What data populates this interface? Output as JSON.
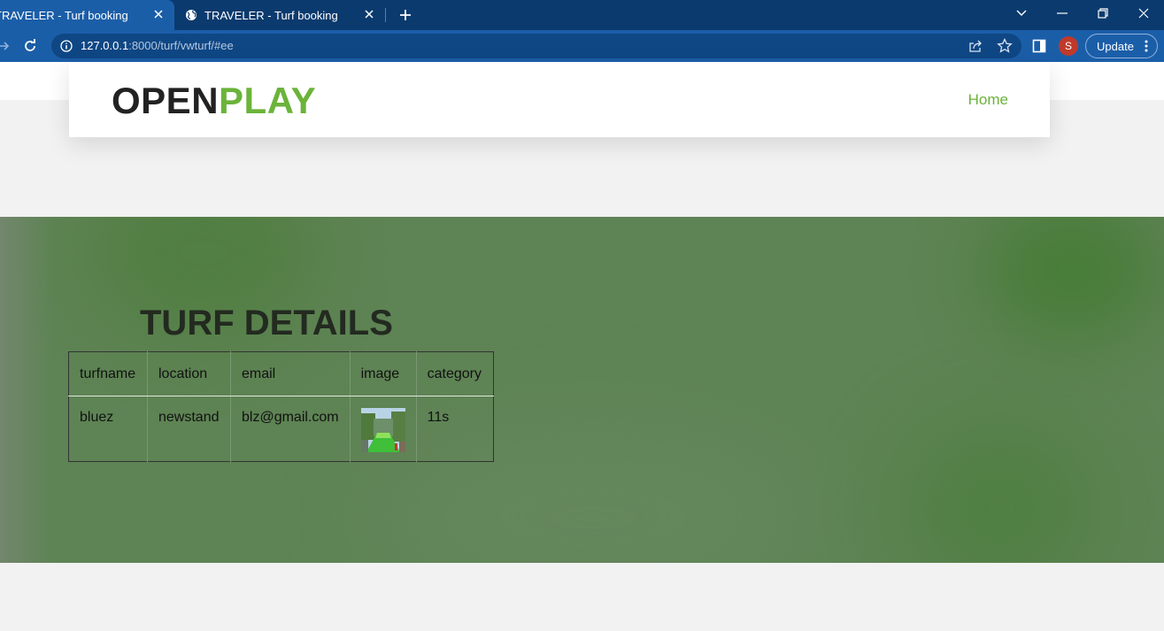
{
  "browser": {
    "tabs": [
      {
        "title": "TRAVELER - Turf booking",
        "active": true
      },
      {
        "title": "TRAVELER - Turf booking",
        "active": false
      }
    ],
    "url_host": "127.0.0.1",
    "url_rest": ":8000/turf/vwturf/#ee",
    "avatar_letter": "S",
    "update_label": "Update"
  },
  "site": {
    "logo_part1": "OPEN",
    "logo_part2": "PLAY",
    "nav_home": "Home",
    "colors": {
      "accent": "#6bb33a",
      "hero": "#5e8354"
    }
  },
  "section": {
    "heading": "TURF DETAILS",
    "columns": [
      "turfname",
      "location",
      "email",
      "image",
      "category"
    ],
    "rows": [
      {
        "turfname": "bluez",
        "location": "newstand",
        "email": "blz@gmail.com",
        "category": "11s"
      }
    ]
  }
}
